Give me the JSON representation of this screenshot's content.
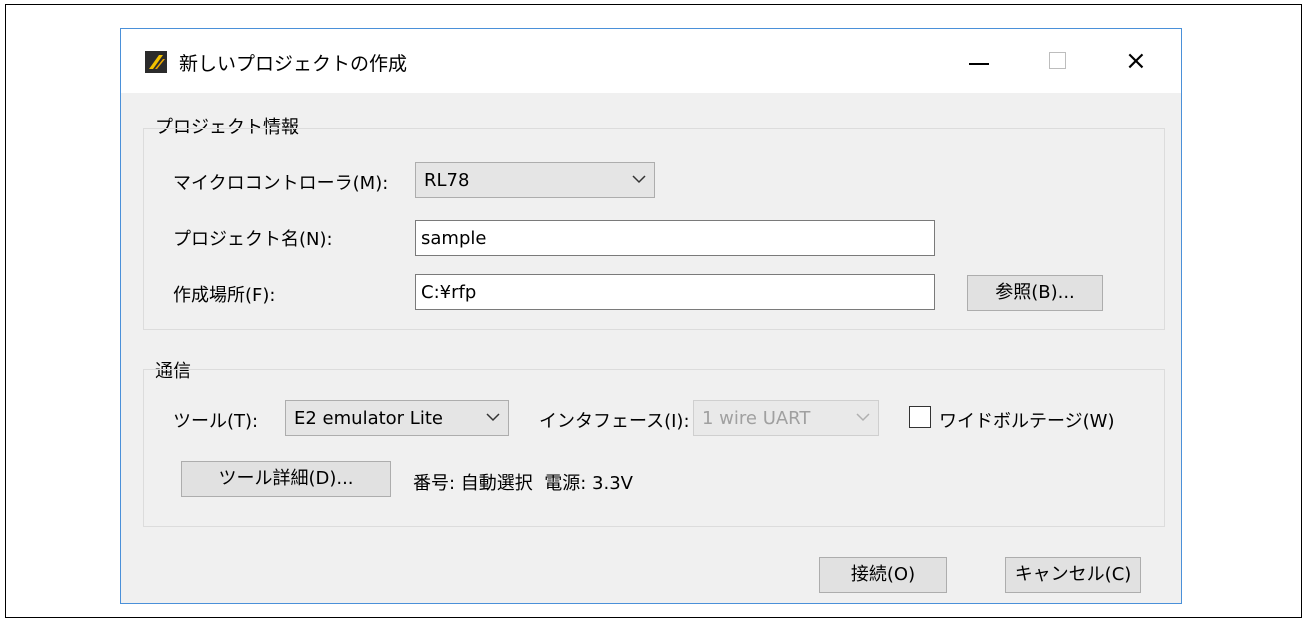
{
  "dialog": {
    "title": "新しいプロジェクトの作成",
    "icon": "app-logo-icon",
    "minimize_glyph": "minimize-icon",
    "maximize_glyph": "maximize-icon",
    "close_glyph": "×"
  },
  "project_info": {
    "group_label": "プロジェクト情報",
    "microcontroller_label": "マイクロコントローラ(M):",
    "microcontroller_value": "RL78",
    "project_name_label": "プロジェクト名(N):",
    "project_name_value": "sample",
    "location_label": "作成場所(F):",
    "location_value": "C:¥rfp",
    "browse_button": "参照(B)..."
  },
  "communication": {
    "group_label": "通信",
    "tool_label": "ツール(T):",
    "tool_value": "E2 emulator Lite",
    "interface_label": "インタフェース(I):",
    "interface_value": "1 wire UART",
    "wide_voltage_label": "ワイドボルテージ(W)",
    "wide_voltage_checked": false,
    "tool_details_button": "ツール詳細(D)...",
    "status_text": "番号: 自動選択  電源: 3.3V"
  },
  "footer": {
    "connect_button": "接続(O)",
    "cancel_button": "キャンセル(C)"
  },
  "colors": {
    "dialog_border": "#4a90d9",
    "dialog_bg": "#f0f0f0",
    "titlebar_bg": "#ffffff"
  }
}
